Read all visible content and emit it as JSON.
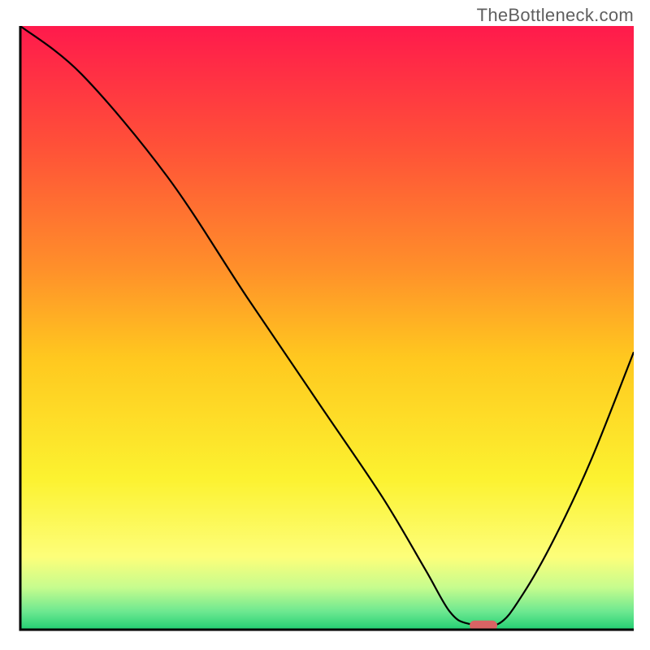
{
  "watermark": "TheBottleneck.com",
  "chart_data": {
    "type": "line",
    "title": "",
    "xlabel": "",
    "ylabel": "",
    "xlim": [
      0,
      100
    ],
    "ylim": [
      0,
      100
    ],
    "grid": false,
    "gradient_background": {
      "stops": [
        {
          "pos": 0.0,
          "color": "#ff1a4c"
        },
        {
          "pos": 0.2,
          "color": "#ff5138"
        },
        {
          "pos": 0.4,
          "color": "#ff8f2a"
        },
        {
          "pos": 0.55,
          "color": "#ffc81f"
        },
        {
          "pos": 0.75,
          "color": "#fcf230"
        },
        {
          "pos": 0.88,
          "color": "#fdfe7a"
        },
        {
          "pos": 0.93,
          "color": "#c6fc8e"
        },
        {
          "pos": 0.97,
          "color": "#6de890"
        },
        {
          "pos": 1.0,
          "color": "#22cf73"
        }
      ]
    },
    "series": [
      {
        "name": "bottleneck-curve",
        "x": [
          0,
          10,
          24,
          37,
          49,
          59,
          66,
          70,
          73,
          78,
          82,
          87,
          93,
          100
        ],
        "y": [
          100,
          92,
          75,
          55,
          37,
          22,
          10,
          3,
          1,
          1,
          6,
          15,
          28,
          46
        ]
      }
    ],
    "marker": {
      "name": "optimal-point",
      "x": 75.5,
      "y": 0.7,
      "color": "#da6364"
    }
  }
}
